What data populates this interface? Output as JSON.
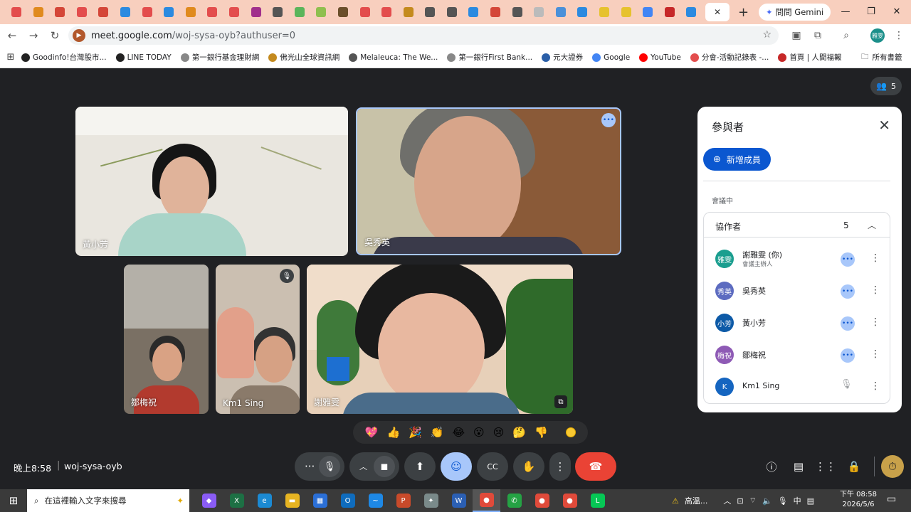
{
  "tabs": {
    "icon_colors": [
      "#e34d4d",
      "#e08a1e",
      "#d44638",
      "#e34d4d",
      "#d44638",
      "#2b8ae0",
      "#e34d4d",
      "#2b8ae0",
      "#e08a1e",
      "#e34d4d",
      "#e34d4d",
      "#a12f8c",
      "#555555",
      "#5bb55b",
      "#8fbf4f",
      "#6b4f2b",
      "#e34d4d",
      "#e34d4d",
      "#c48a1e",
      "#555555",
      "#555555",
      "#2b8ae0",
      "#d44638",
      "#555555",
      "#bbbbbb",
      "#4a90d9",
      "#2b8ae0",
      "#e6c22e",
      "#e6c22e",
      "#4285f4",
      "#c62828",
      "#2b8ae0"
    ],
    "active_close": "✕",
    "new_tab": "+"
  },
  "gemini": {
    "label": "問問 Gemini",
    "icon": "sparkle-icon"
  },
  "window": {
    "minimize": "—",
    "restore": "❐",
    "close": "✕"
  },
  "omnibox": {
    "url_host": "meet.google.com",
    "url_path": "/woj-sysa-oyb?authuser=0"
  },
  "bookmarks": [
    {
      "label": "Goodinfo!台灣股市...",
      "color": "#222222"
    },
    {
      "label": "LINE TODAY",
      "color": "#222222"
    },
    {
      "label": "第一銀行基金理財網",
      "color": "#888888"
    },
    {
      "label": "佛光山全球資訊網",
      "color": "#c48a1e"
    },
    {
      "label": "Melaleuca: The We...",
      "color": "#555555"
    },
    {
      "label": "第一銀行First Bank...",
      "color": "#888888"
    },
    {
      "label": "元大證券",
      "color": "#2b5fa8"
    },
    {
      "label": "Google",
      "color": "#4285f4"
    },
    {
      "label": "YouTube",
      "color": "#ff0000"
    },
    {
      "label": "分會-活動記錄表 -...",
      "color": "#e34d4d"
    },
    {
      "label": "首頁 | 人間福報",
      "color": "#c62828"
    }
  ],
  "bookmarks_more": "»",
  "all_bookmarks": "所有書籤",
  "meet": {
    "people_count": "5",
    "tiles": {
      "t1_name": "黃小芳",
      "t2_name": "吳秀英",
      "t3_name": "鄒梅祝",
      "t4_name": "Km1 Sing",
      "t5_name": "謝雅雯"
    },
    "panel": {
      "title": "參與者",
      "add_label": "新增成員",
      "in_meeting": "會議中",
      "group_label": "協作者",
      "group_count": "5",
      "participants": [
        {
          "name": "謝雅雯 (你)",
          "sub": "會議主辦人",
          "initials": "雅雯",
          "color": "#1a9e8f"
        },
        {
          "name": "吳秀英",
          "sub": "",
          "initials": "秀英",
          "color": "#5c6bc0"
        },
        {
          "name": "黃小芳",
          "sub": "",
          "initials": "小芳",
          "color": "#0d5aa7"
        },
        {
          "name": "鄒梅祝",
          "sub": "",
          "initials": "梅祝",
          "color": "#8e5ab5"
        },
        {
          "name": "Km1 Sing",
          "sub": "",
          "initials": "K",
          "color": "#1565c0"
        }
      ]
    },
    "reactions": [
      "💖",
      "👍",
      "🎉",
      "👏",
      "😂",
      "😮",
      "😢",
      "🤔",
      "👎"
    ],
    "time": "晚上8:58",
    "meeting_code": "woj-sysa-oyb"
  },
  "taskbar": {
    "search_placeholder": "在這裡輸入文字來搜尋",
    "apps": [
      {
        "name": "copilot",
        "color": "#8a5cf5",
        "glyph": "◆"
      },
      {
        "name": "excel",
        "color": "#1d7044",
        "glyph": "X"
      },
      {
        "name": "edge",
        "color": "#1b8ad3",
        "glyph": "e"
      },
      {
        "name": "file-explorer",
        "color": "#e6b422",
        "glyph": "▬"
      },
      {
        "name": "store",
        "color": "#2b6fd6",
        "glyph": "▦"
      },
      {
        "name": "outlook",
        "color": "#0f6cbd",
        "glyph": "O"
      },
      {
        "name": "messenger",
        "color": "#1e88e5",
        "glyph": "~"
      },
      {
        "name": "powerpoint",
        "color": "#c84a2a",
        "glyph": "P"
      },
      {
        "name": "bird-app",
        "color": "#7a8a8a",
        "glyph": "✦"
      },
      {
        "name": "word",
        "color": "#2b5fb3",
        "glyph": "W"
      },
      {
        "name": "chrome",
        "color": "#e04a3a",
        "glyph": "●"
      },
      {
        "name": "whatsapp",
        "color": "#25a244",
        "glyph": "✆"
      },
      {
        "name": "chrome-2",
        "color": "#e04a3a",
        "glyph": "●"
      },
      {
        "name": "chrome-3",
        "color": "#e04a3a",
        "glyph": "●"
      },
      {
        "name": "line",
        "color": "#06c755",
        "glyph": "L"
      }
    ],
    "tray_warning": "高溫...",
    "ime": "中",
    "clock_time": "下午 08:58",
    "clock_date": "2026/5/6"
  }
}
